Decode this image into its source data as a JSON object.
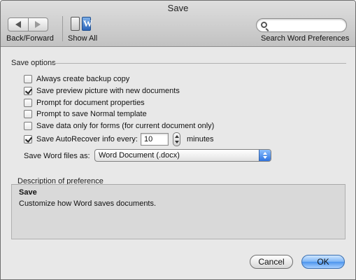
{
  "window": {
    "title": "Save"
  },
  "toolbar": {
    "back_forward_label": "Back/Forward",
    "show_all_label": "Show All",
    "show_all_glyph": "W",
    "search_placeholder": "",
    "search_label": "Search Word Preferences"
  },
  "save_options": {
    "group_title": "Save options",
    "options": [
      {
        "label": "Always create backup copy",
        "checked": false
      },
      {
        "label": "Save preview picture with new documents",
        "checked": true
      },
      {
        "label": "Prompt for document properties",
        "checked": false
      },
      {
        "label": "Prompt to save Normal template",
        "checked": false
      },
      {
        "label": "Save data only for forms (for current document only)",
        "checked": false
      },
      {
        "label": "Save AutoRecover info every:",
        "checked": true
      }
    ],
    "autorecover_value": "10",
    "autorecover_unit": "minutes",
    "format_label": "Save Word files as:",
    "format_value": "Word Document (.docx)"
  },
  "description": {
    "group_title": "Description of preference",
    "title": "Save",
    "text": "Customize how Word saves documents."
  },
  "buttons": {
    "cancel": "Cancel",
    "ok": "OK"
  },
  "colors": {
    "accent": "#4d95ee",
    "panel": "#e8e8e8",
    "description_bg": "#d9d9d9"
  }
}
